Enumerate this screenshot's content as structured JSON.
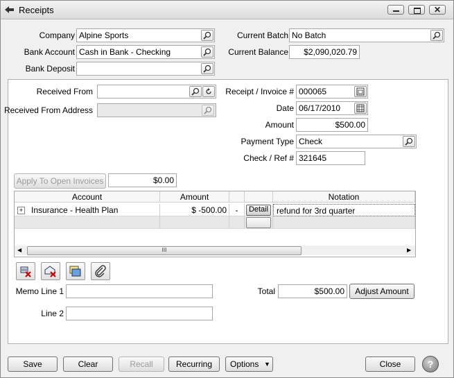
{
  "window": {
    "title": "Receipts",
    "close_glyph": "✕"
  },
  "header": {
    "company_label": "Company",
    "company_value": "Alpine Sports",
    "bank_account_label": "Bank Account",
    "bank_account_value": "Cash in Bank - Checking",
    "bank_deposit_label": "Bank Deposit",
    "bank_deposit_value": "",
    "current_batch_label": "Current Batch",
    "current_batch_value": "No Batch",
    "current_balance_label": "Current Balance",
    "current_balance_value": "$2,090,020.79"
  },
  "receipt": {
    "received_from_label": "Received From",
    "received_from_value": "",
    "received_from_address_label": "Received From Address",
    "received_from_address_value": "",
    "invoice_label": "Receipt / Invoice #",
    "invoice_value": "000065",
    "date_label": "Date",
    "date_value": "06/17/2010",
    "amount_label": "Amount",
    "amount_value": "$500.00",
    "payment_type_label": "Payment Type",
    "payment_type_value": "Check",
    "check_ref_label": "Check / Ref #",
    "check_ref_value": "321645",
    "apply_button": "Apply To Open Invoices",
    "apply_amount": "$0.00"
  },
  "grid": {
    "columns": [
      "Account",
      "Amount",
      "Notation"
    ],
    "rows": [
      {
        "expand": "+",
        "account": "Insurance - Health Plan",
        "amount": "$ -500.00",
        "sign": "-",
        "detail": "Detail",
        "notation": "refund for 3rd quarter"
      }
    ],
    "scroll_grip": "III"
  },
  "toolbar": {
    "icons": [
      "delete-line-icon",
      "clear-line-icon",
      "edit-line-icon",
      "attachment-icon"
    ]
  },
  "memo": {
    "line1_label": "Memo Line 1",
    "line1_value": "",
    "line2_label": "Line 2",
    "line2_value": "",
    "total_label": "Total",
    "total_value": "$500.00",
    "adjust_button": "Adjust Amount"
  },
  "footer": {
    "save": "Save",
    "clear": "Clear",
    "recall": "Recall",
    "recurring": "Recurring",
    "options": "Options",
    "options_arrow": "▼",
    "close": "Close",
    "help": "?"
  }
}
